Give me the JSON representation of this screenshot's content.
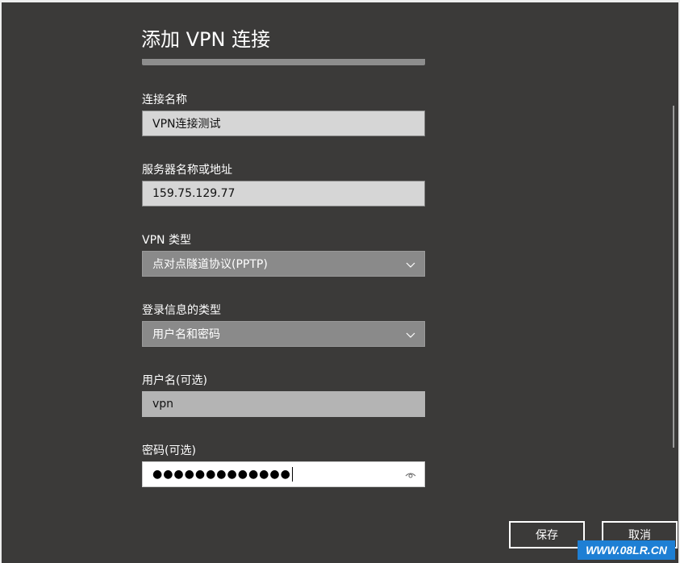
{
  "dialog": {
    "title": "添加 VPN 连接"
  },
  "fields": {
    "connection_name": {
      "label": "连接名称",
      "value": "VPN连接测试"
    },
    "server": {
      "label": "服务器名称或地址",
      "value": "159.75.129.77"
    },
    "vpn_type": {
      "label": "VPN 类型",
      "value": "点对点隧道协议(PPTP)"
    },
    "signin_type": {
      "label": "登录信息的类型",
      "value": "用户名和密码"
    },
    "username": {
      "label": "用户名(可选)",
      "value": "vpn"
    },
    "password": {
      "label": "密码(可选)",
      "value": "●●●●●●●●●●●●●"
    }
  },
  "buttons": {
    "save": "保存",
    "cancel": "取消"
  },
  "watermark": "WWW.08LR.CN",
  "icons": {
    "dropdown": "chevron-down-icon",
    "reveal_password": "eye-icon"
  },
  "colors": {
    "background": "#3b3a39",
    "field": "#d6d6d6",
    "select": "#8a8a8a",
    "watermark": "#1e7fd4"
  }
}
